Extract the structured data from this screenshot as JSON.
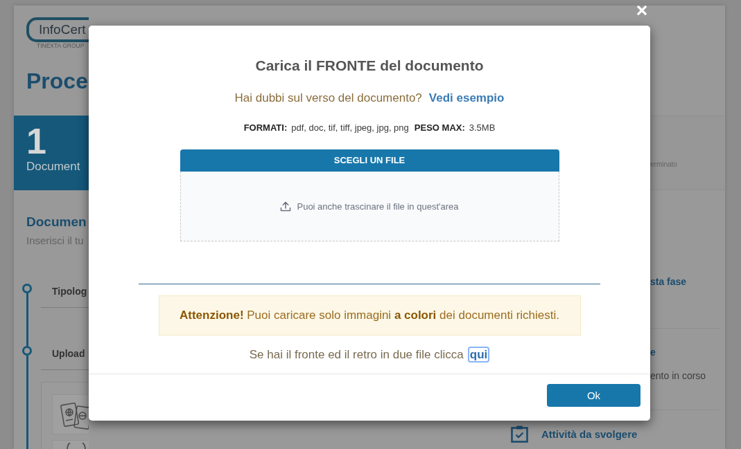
{
  "background_page": {
    "logo": {
      "name": "InfoCert",
      "tagline": "TINEXTA GROUP"
    },
    "title": "Proce",
    "steps": [
      {
        "number": "1",
        "label": "Document",
        "selected": true
      },
      {
        "label": "erminato",
        "selected": false
      }
    ],
    "section": {
      "title": "Documen",
      "subtitle": "Inserisci il tu"
    },
    "timeline": [
      {
        "label": "Tipolog"
      },
      {
        "label": "Upload"
      }
    ],
    "side_panel": {
      "rows": [
        {
          "title": "sta fase"
        },
        {
          "title": "e",
          "text": "ento in corso"
        }
      ],
      "tasks_link": "Attività da svolgere"
    }
  },
  "modal": {
    "title": "Carica il FRONTE del documento",
    "example_prompt": {
      "text": "Hai dubbi sul verso del documento?",
      "link": "Vedi esempio"
    },
    "file_info": [
      {
        "label": "FORMATI:",
        "value": "pdf, doc, tif, tiff, jpeg, jpg, png"
      },
      {
        "label": "PESO MAX:",
        "value": "3.5MB"
      }
    ],
    "upload": {
      "button": "SCEGLI UN FILE",
      "drop_hint": "Puoi anche trascinare il file in quest'area"
    },
    "alert": "**Attenzione!** Puoi caricare solo immagini **a colori** dei documenti richiesti.",
    "split_files": {
      "text": "Se hai il fronte ed il retro in due file clicca",
      "link": {
        "label": "qui",
        "focused": true
      }
    },
    "buttons": [
      {
        "label": "Ok"
      }
    ]
  }
}
